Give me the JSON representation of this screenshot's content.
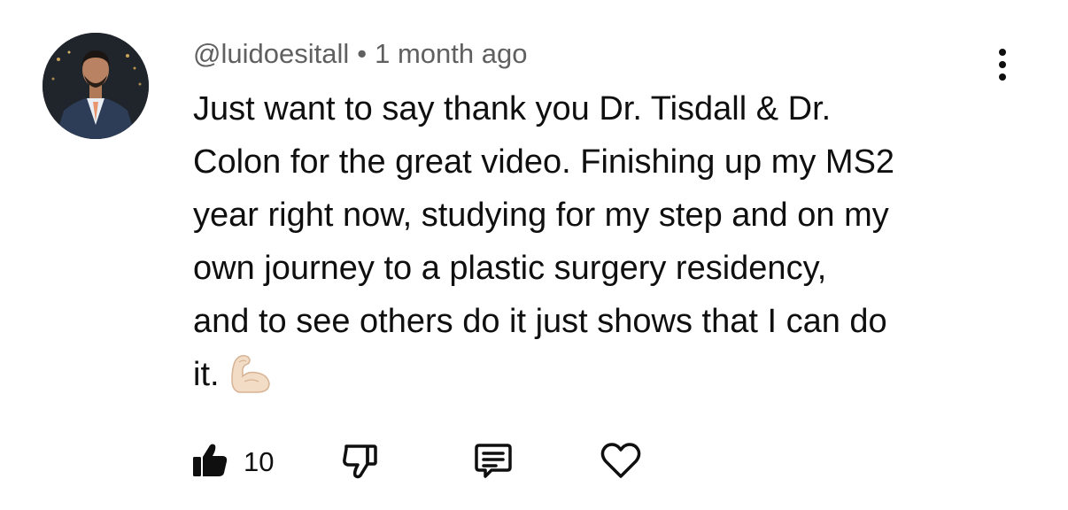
{
  "comment": {
    "author": "@luidoesitall",
    "separator": "•",
    "timestamp": "1 month ago",
    "text_lines": [
      "Just want to say thank you Dr. Tisdall & Dr.",
      "Colon for the great video. Finishing up my MS2",
      "year right now, studying for my step and on my",
      "own journey to a plastic surgery residency,",
      "and to see others do it just shows that I can do",
      "it."
    ],
    "emoji": "flexed-biceps",
    "like_count": "10"
  },
  "icons": {
    "like": "thumbs-up-icon",
    "dislike": "thumbs-down-icon",
    "reply": "reply-comment-icon",
    "heart": "heart-icon",
    "more": "more-vertical-icon"
  },
  "colors": {
    "text": "#0f0f0f",
    "meta": "#606060",
    "background": "#ffffff",
    "emoji_skin": "#f3dcc6"
  }
}
